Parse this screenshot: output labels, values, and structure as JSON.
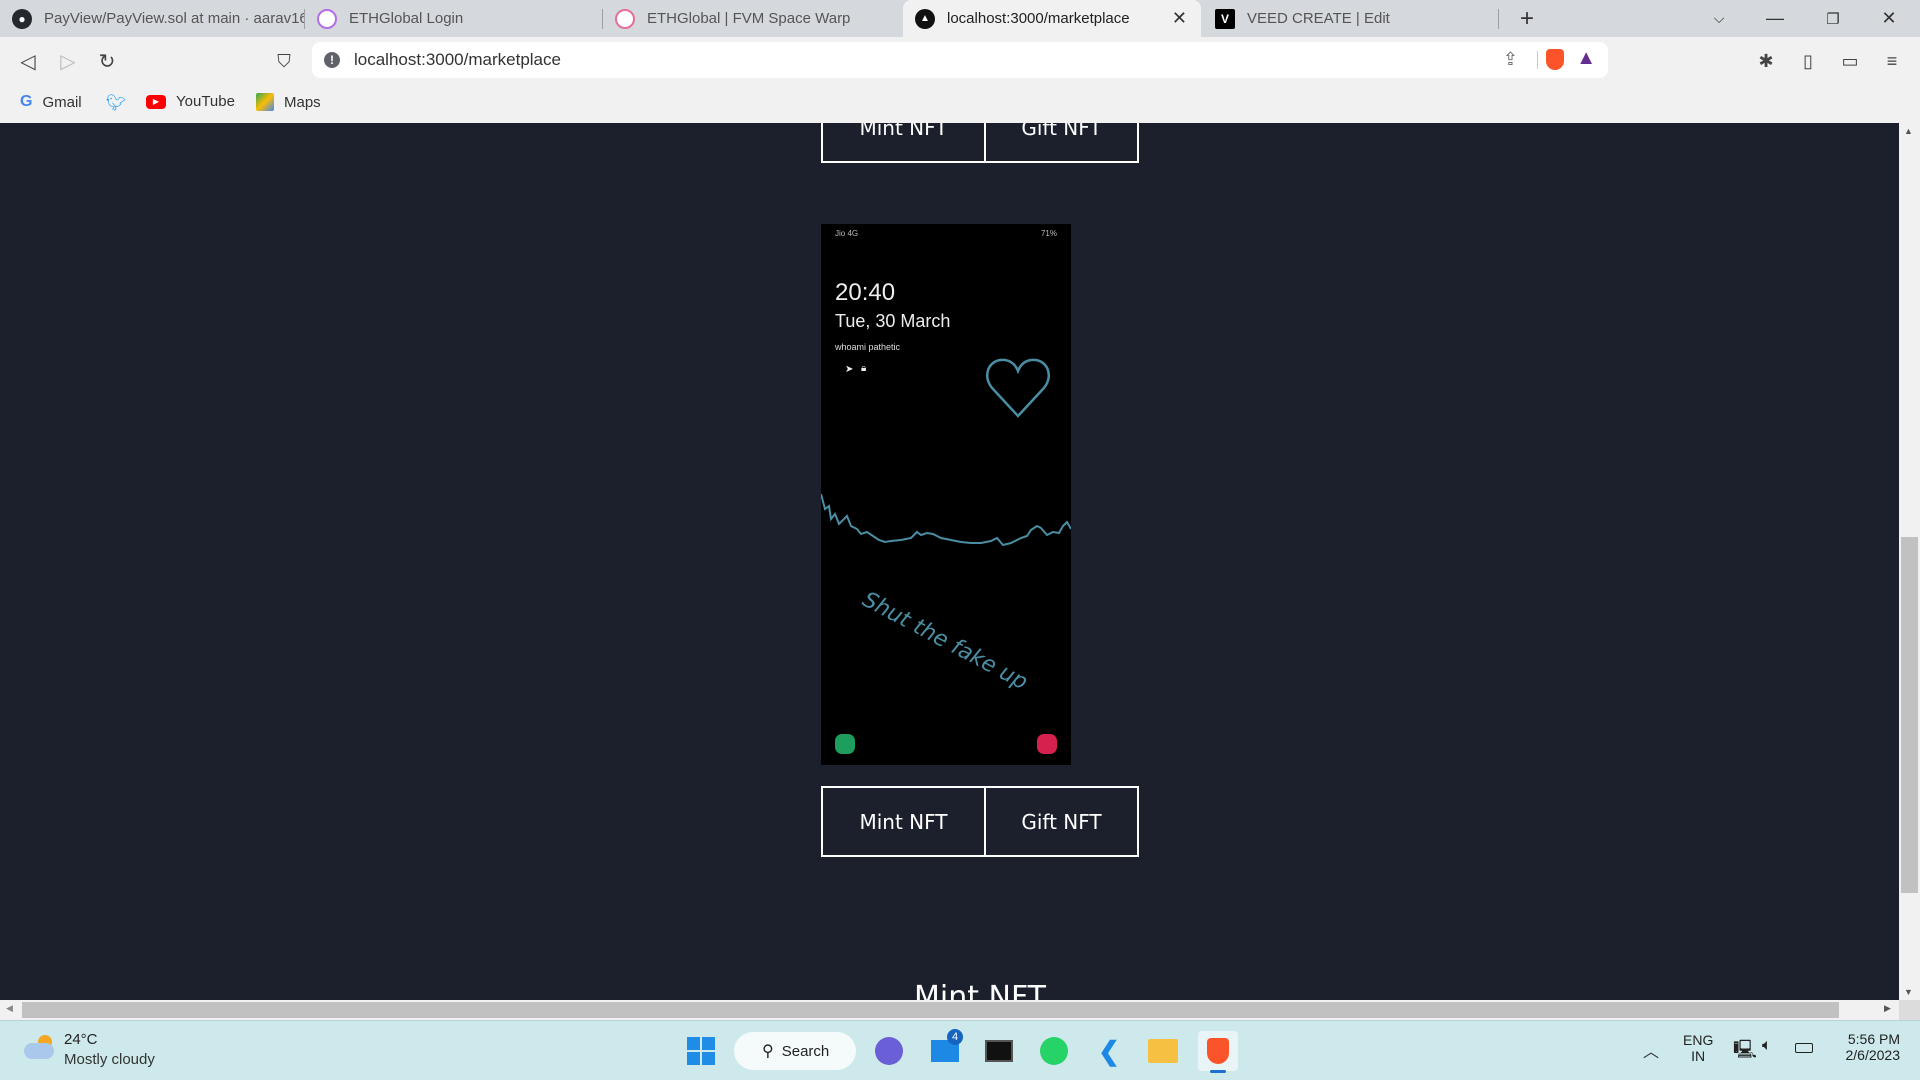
{
  "browser": {
    "tabs": [
      {
        "title": "PayView/PayView.sol at main · aarav16",
        "icon": "github-icon",
        "active": false
      },
      {
        "title": "ETHGlobal Login",
        "icon": "ethglobal-icon",
        "active": false
      },
      {
        "title": "ETHGlobal | FVM Space Warp",
        "icon": "ethglobal-icon",
        "active": false
      },
      {
        "title": "localhost:3000/marketplace",
        "icon": "site-icon",
        "active": true
      },
      {
        "title": "VEED CREATE | Edit",
        "icon": "veed-icon",
        "active": false
      }
    ],
    "new_tab_label": "+",
    "url": "localhost:3000/marketplace",
    "bookmarks": [
      {
        "label": "Gmail",
        "icon": "google-icon"
      },
      {
        "label": "",
        "icon": "twitter-icon"
      },
      {
        "label": "YouTube",
        "icon": "youtube-icon"
      },
      {
        "label": "Maps",
        "icon": "maps-icon"
      }
    ]
  },
  "page": {
    "top_buttons": {
      "mint": "Mint NFT",
      "gift": "Gift NFT"
    },
    "nft_image": {
      "carrier": "Jio 4G",
      "battery": "71%",
      "time": "20:40",
      "date": "Tue, 30 March",
      "owner_text": "whoami pathetic",
      "caption": "Shut the fake up",
      "accent_color": "#4b8ea3"
    },
    "bottom_buttons": {
      "mint": "Mint NFT",
      "gift": "Gift NFT"
    },
    "partial_heading": "Mint NFT"
  },
  "taskbar": {
    "weather": {
      "temp": "24°C",
      "condition": "Mostly cloudy"
    },
    "search_label": "Search",
    "mail_badge": "4",
    "language": {
      "line1": "ENG",
      "line2": "IN"
    },
    "clock": {
      "time": "5:56 PM",
      "date": "2/6/2023"
    }
  }
}
